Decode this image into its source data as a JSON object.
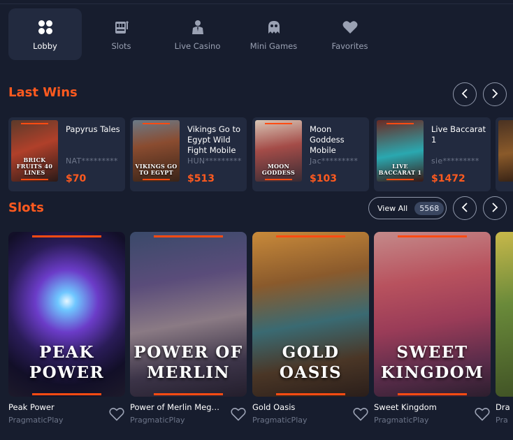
{
  "nav": [
    {
      "label": "Lobby",
      "icon": "grid-icon",
      "active": true
    },
    {
      "label": "Slots",
      "icon": "slot-machine-icon",
      "active": false
    },
    {
      "label": "Live Casino",
      "icon": "dealer-icon",
      "active": false
    },
    {
      "label": "Mini Games",
      "icon": "ghost-icon",
      "active": false
    },
    {
      "label": "Favorites",
      "icon": "heart-icon",
      "active": false
    }
  ],
  "last_wins": {
    "title": "Last Wins",
    "items": [
      {
        "game": "Papyrus Tales",
        "user": "NAT*********",
        "amount": "$70",
        "art_text": "BRICK FRUITS 40 LINES"
      },
      {
        "game": "Vikings Go to Egypt Wild Fight Mobile",
        "user": "HUN*********",
        "amount": "$513",
        "art_text": "VIKINGS GO TO EGYPT"
      },
      {
        "game": "Moon Goddess Mobile",
        "user": "Jac*********",
        "amount": "$103",
        "art_text": "MOON GODDESS"
      },
      {
        "game": "Live Baccarat 1",
        "user": "sie*********",
        "amount": "$1472",
        "art_text": "LIVE BACCARAT 1"
      }
    ]
  },
  "slots": {
    "title": "Slots",
    "view_all_label": "View All",
    "count": "5568",
    "items": [
      {
        "name": "Peak Power",
        "provider": "PragmaticPlay",
        "art_text": "PEAK POWER"
      },
      {
        "name": "Power of Merlin Mega…",
        "provider": "PragmaticPlay",
        "art_text": "POWER OF MERLIN"
      },
      {
        "name": "Gold Oasis",
        "provider": "PragmaticPlay",
        "art_text": "GOLD OASIS"
      },
      {
        "name": "Sweet Kingdom",
        "provider": "PragmaticPlay",
        "art_text": "SWEET KINGDOM"
      },
      {
        "name": "Dra",
        "provider": "Pra",
        "art_text": ""
      }
    ]
  },
  "colors": {
    "accent": "#ff5a1f",
    "background": "#171d2e",
    "card": "#222a3f"
  }
}
